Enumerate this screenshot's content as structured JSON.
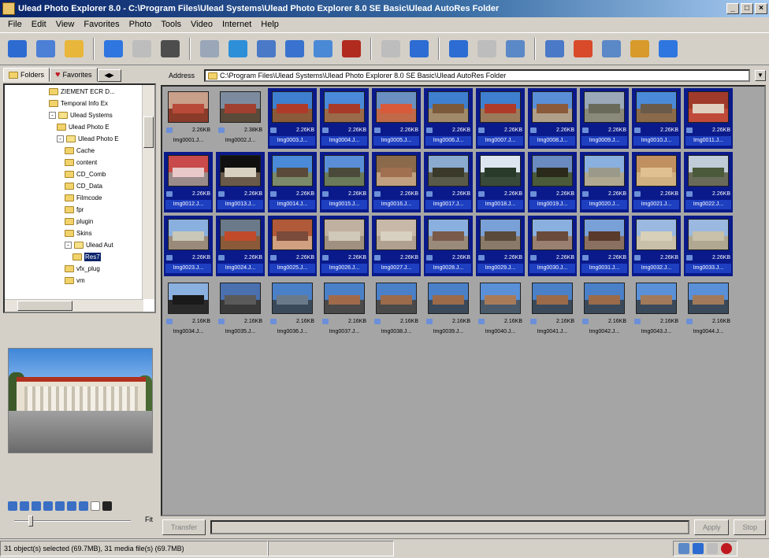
{
  "window": {
    "title": "Ulead Photo Explorer 8.0 - C:\\Program Files\\Ulead Systems\\Ulead Photo Explorer 8.0 SE Basic\\Ulead AutoRes Folder",
    "min": "_",
    "max": "□",
    "close": "×"
  },
  "menu": [
    "File",
    "Edit",
    "View",
    "Favorites",
    "Photo",
    "Tools",
    "Video",
    "Internet",
    "Help"
  ],
  "toolbar": {
    "buttons": [
      {
        "name": "thumbnail-view-icon",
        "color": "#2d6bd1"
      },
      {
        "name": "window-view-icon",
        "color": "#4c7fd6"
      },
      {
        "name": "folder-up-icon",
        "color": "#e8b63a"
      },
      {
        "name": "back-arrow-icon",
        "color": "#2f76e0"
      },
      {
        "name": "forward-arrow-icon",
        "color": "#bdbdbd"
      },
      {
        "name": "camera-icon",
        "color": "#4d4d4d"
      },
      {
        "name": "scanner-icon",
        "color": "#9aa7b8"
      },
      {
        "name": "acquire-icon",
        "color": "#2d8fd8"
      },
      {
        "name": "photo-edit-icon",
        "color": "#4a79c8"
      },
      {
        "name": "slideshow-icon",
        "color": "#3a73cf"
      },
      {
        "name": "info-icon",
        "color": "#4a89d6"
      },
      {
        "name": "red-eye-icon",
        "color": "#b12b1e"
      },
      {
        "name": "magic-wand-icon",
        "color": "#bdbdbd"
      },
      {
        "name": "rotate-left-icon",
        "color": "#2c6cd3"
      },
      {
        "name": "rotate-right-icon",
        "color": "#2c6cd3"
      },
      {
        "name": "flip-icon",
        "color": "#bdbdbd"
      },
      {
        "name": "print-icon",
        "color": "#5b88c6"
      },
      {
        "name": "monitor-icon",
        "color": "#4a79c8"
      },
      {
        "name": "calendar-icon",
        "color": "#d84a2a"
      },
      {
        "name": "email-icon",
        "color": "#5b88c6"
      },
      {
        "name": "web-album-icon",
        "color": "#d89a2a"
      },
      {
        "name": "help-icon",
        "color": "#2f76e0"
      }
    ]
  },
  "left_tabs": {
    "folders": "Folders",
    "favorites": "Favorites",
    "more": "◀▶"
  },
  "tree": {
    "items": [
      {
        "label": "ZIEMENT ECR D...",
        "indent": 0,
        "pm": "",
        "open": false
      },
      {
        "label": "Temporal Info Ex",
        "indent": 0,
        "pm": "",
        "open": false
      },
      {
        "label": "Ulead Systems",
        "indent": 0,
        "pm": "-",
        "open": true
      },
      {
        "label": "Ulead Photo E",
        "indent": 1,
        "pm": "",
        "open": false
      },
      {
        "label": "Ulead Photo E",
        "indent": 1,
        "pm": "-",
        "open": true
      },
      {
        "label": "Cache",
        "indent": 2,
        "pm": "",
        "open": false
      },
      {
        "label": "content",
        "indent": 2,
        "pm": "",
        "open": false
      },
      {
        "label": "CD_Comb",
        "indent": 2,
        "pm": "",
        "open": false
      },
      {
        "label": "CD_Data",
        "indent": 2,
        "pm": "",
        "open": false
      },
      {
        "label": "Filmcode",
        "indent": 2,
        "pm": "",
        "open": false
      },
      {
        "label": "fpr",
        "indent": 2,
        "pm": "",
        "open": false
      },
      {
        "label": "plugin",
        "indent": 2,
        "pm": "",
        "open": false
      },
      {
        "label": "Skins",
        "indent": 2,
        "pm": "",
        "open": false
      },
      {
        "label": "Ulead Aut",
        "indent": 2,
        "pm": "-",
        "open": true
      },
      {
        "label": "Res7",
        "indent": 3,
        "pm": "",
        "open": false
      },
      {
        "label": "vfx_plug",
        "indent": 2,
        "pm": "",
        "open": false
      },
      {
        "label": "vm",
        "indent": 2,
        "pm": "",
        "open": false
      }
    ]
  },
  "preview_tools": {
    "zoom_label": "Fit"
  },
  "address": {
    "label": "Address",
    "value": "C:\\Program Files\\Ulead Systems\\Ulead Photo Explorer 8.0 SE Basic\\Ulead AutoRes Folder"
  },
  "thumbnails": [
    {
      "name": "Img0001.J...",
      "size": "2.26KB",
      "sel": false,
      "sky": "#c9a08a",
      "ground": "#8a3b2a",
      "bldg": "#b84a3a"
    },
    {
      "name": "Img0002.J...",
      "size": "2.38KB",
      "sel": false,
      "sky": "#7c8c9e",
      "ground": "#5a4a3a",
      "bldg": "#a04030"
    },
    {
      "name": "Img0003.J...",
      "size": "2.26KB",
      "sel": true,
      "sky": "#3f7fd0",
      "ground": "#8a5a3a",
      "bldg": "#b03a2a"
    },
    {
      "name": "Img0004.J...",
      "size": "2.26KB",
      "sel": true,
      "sky": "#4a8ad8",
      "ground": "#9a6a4a",
      "bldg": "#a83a2a"
    },
    {
      "name": "Img0005.J...",
      "size": "2.26KB",
      "sel": true,
      "sky": "#6a8fc0",
      "ground": "#c06a4a",
      "bldg": "#d85a3a"
    },
    {
      "name": "Img0006.J...",
      "size": "2.26KB",
      "sel": true,
      "sky": "#3f7fd0",
      "ground": "#a08a6a",
      "bldg": "#7a5a3a"
    },
    {
      "name": "Img0007.J...",
      "size": "2.26KB",
      "sel": true,
      "sky": "#3f7fd0",
      "ground": "#9a7a5a",
      "bldg": "#b03a2a"
    },
    {
      "name": "Img0008.J...",
      "size": "2.26KB",
      "sel": true,
      "sky": "#5a8fd8",
      "ground": "#b0a08a",
      "bldg": "#8a5a3a"
    },
    {
      "name": "Img0009.J...",
      "size": "2.26KB",
      "sel": true,
      "sky": "#9aa8b8",
      "ground": "#8a8a7a",
      "bldg": "#6a6a5a"
    },
    {
      "name": "Img0010.J...",
      "size": "2.26KB",
      "sel": true,
      "sky": "#4a8ad8",
      "ground": "#8a6a4a",
      "bldg": "#6a5a4a"
    },
    {
      "name": "Img0011.J...",
      "size": "2.26KB",
      "sel": true,
      "sky": "#a03a2a",
      "ground": "#c04a3a",
      "bldg": "#e0d0c0"
    },
    {
      "name": "Img0012.J...",
      "size": "2.26KB",
      "sel": true,
      "sky": "#c84a4a",
      "ground": "#9a8a8a",
      "bldg": "#e8c8c8"
    },
    {
      "name": "Img0013.J...",
      "size": "2.26KB",
      "sel": true,
      "sky": "#101010",
      "ground": "#6a5a4a",
      "bldg": "#d8d0c0"
    },
    {
      "name": "Img0014.J...",
      "size": "2.26KB",
      "sel": true,
      "sky": "#4a8ad8",
      "ground": "#7a8a6a",
      "bldg": "#5a4a3a"
    },
    {
      "name": "Img0015.J...",
      "size": "2.26KB",
      "sel": true,
      "sky": "#5a8fd8",
      "ground": "#6a7a5a",
      "bldg": "#4a4a3a"
    },
    {
      "name": "Img0016.J...",
      "size": "2.26KB",
      "sel": true,
      "sky": "#8a6a4a",
      "ground": "#c0a080",
      "bldg": "#a07050"
    },
    {
      "name": "Img0017.J...",
      "size": "2.26KB",
      "sel": true,
      "sky": "#8aaad0",
      "ground": "#5a5a4a",
      "bldg": "#3a3a2a"
    },
    {
      "name": "Img0018.J...",
      "size": "2.26KB",
      "sel": true,
      "sky": "#dde6f0",
      "ground": "#3a4a3a",
      "bldg": "#2a3a2a"
    },
    {
      "name": "Img0019.J...",
      "size": "2.26KB",
      "sel": true,
      "sky": "#6a8ac0",
      "ground": "#4a5a3a",
      "bldg": "#2a2a1a"
    },
    {
      "name": "Img0020.J...",
      "size": "2.26KB",
      "sel": true,
      "sky": "#8ab0e0",
      "ground": "#b0a890",
      "bldg": "#9a9a8a"
    },
    {
      "name": "Img0021.J...",
      "size": "2.26KB",
      "sel": true,
      "sky": "#c09060",
      "ground": "#d0b080",
      "bldg": "#e0c090"
    },
    {
      "name": "Img0022.J...",
      "size": "2.26KB",
      "sel": true,
      "sky": "#c0ccd8",
      "ground": "#6a6a5a",
      "bldg": "#4a5a3a"
    },
    {
      "name": "Img0023.J...",
      "size": "2.26KB",
      "sel": true,
      "sky": "#8ab0e0",
      "ground": "#9a8a7a",
      "bldg": "#c8c8b8"
    },
    {
      "name": "Img0024.J...",
      "size": "2.26KB",
      "sel": true,
      "sky": "#6a7a8a",
      "ground": "#8a5a3a",
      "bldg": "#c04a2a"
    },
    {
      "name": "Img0025.J...",
      "size": "2.26KB",
      "sel": true,
      "sky": "#b05a3a",
      "ground": "#d0a080",
      "bldg": "#7a4a3a"
    },
    {
      "name": "Img0026.J...",
      "size": "2.26KB",
      "sel": true,
      "sky": "#c0b0a0",
      "ground": "#a09080",
      "bldg": "#d0c8b8"
    },
    {
      "name": "Img0027.J...",
      "size": "2.26KB",
      "sel": true,
      "sky": "#c8b8a8",
      "ground": "#b0a090",
      "bldg": "#d8d0c0"
    },
    {
      "name": "Img0028.J...",
      "size": "2.26KB",
      "sel": true,
      "sky": "#8ab0e0",
      "ground": "#9a8a7a",
      "bldg": "#7a5a4a"
    },
    {
      "name": "Img0029.J...",
      "size": "2.26KB",
      "sel": true,
      "sky": "#7aa0d8",
      "ground": "#8a7a6a",
      "bldg": "#5a4a3a"
    },
    {
      "name": "Img0030.J...",
      "size": "2.26KB",
      "sel": true,
      "sky": "#8ab0e0",
      "ground": "#9a8070",
      "bldg": "#6a4a3a"
    },
    {
      "name": "Img0031.J...",
      "size": "2.26KB",
      "sel": true,
      "sky": "#7aa0d8",
      "ground": "#8a7060",
      "bldg": "#5a3a2a"
    },
    {
      "name": "Img0032.J...",
      "size": "2.26KB",
      "sel": true,
      "sky": "#9ab8e0",
      "ground": "#c8c0a8",
      "bldg": "#d8d0b8"
    },
    {
      "name": "Img0033.J...",
      "size": "2.26KB",
      "sel": true,
      "sky": "#9ab8e0",
      "ground": "#b0a890",
      "bldg": "#c8c0a8"
    },
    {
      "name": "Img0034.J...",
      "size": "2.16KB",
      "sel": false,
      "sky": "#8ab0e0",
      "ground": "#2a2a2a",
      "bldg": "#1a1a1a"
    },
    {
      "name": "Img0035.J...",
      "size": "2.16KB",
      "sel": false,
      "sky": "#4a70b0",
      "ground": "#3a3a3a",
      "bldg": "#5a5a5a"
    },
    {
      "name": "Img0036.J...",
      "size": "2.16KB",
      "sel": false,
      "sky": "#4a80c8",
      "ground": "#3a4a5a",
      "bldg": "#6a7a8a"
    },
    {
      "name": "Img0037.J...",
      "size": "2.16KB",
      "sel": false,
      "sky": "#4a80c8",
      "ground": "#4a4a4a",
      "bldg": "#a06a4a"
    },
    {
      "name": "Img0038.J...",
      "size": "2.16KB",
      "sel": false,
      "sky": "#4a80c8",
      "ground": "#4a4a4a",
      "bldg": "#9a6a4a"
    },
    {
      "name": "Img0039.J...",
      "size": "2.16KB",
      "sel": false,
      "sky": "#4a80c8",
      "ground": "#3a4a5a",
      "bldg": "#9a6a4a"
    },
    {
      "name": "Img0040.J...",
      "size": "2.16KB",
      "sel": false,
      "sky": "#5a90d8",
      "ground": "#4a5a6a",
      "bldg": "#a87a5a"
    },
    {
      "name": "Img0041.J...",
      "size": "2.16KB",
      "sel": false,
      "sky": "#4a80c8",
      "ground": "#3a4a5a",
      "bldg": "#9a6a4a"
    },
    {
      "name": "Img0042.J...",
      "size": "2.16KB",
      "sel": false,
      "sky": "#4a80c8",
      "ground": "#3a4a5a",
      "bldg": "#9a6a4a"
    },
    {
      "name": "Img0043.J...",
      "size": "2.16KB",
      "sel": false,
      "sky": "#5a90d8",
      "ground": "#3a4a5a",
      "bldg": "#a07a5a"
    },
    {
      "name": "Img0044.J...",
      "size": "2.16KB",
      "sel": false,
      "sky": "#5a90d8",
      "ground": "#3a4a5a",
      "bldg": "#a07a5a"
    }
  ],
  "bottom": {
    "left_button": "Transfer",
    "right_button1": "Apply",
    "right_button2": "Stop",
    "progress": 0
  },
  "status": {
    "text": "31 object(s) selected (69.7MB), 31 media file(s) (69.7MB)"
  }
}
